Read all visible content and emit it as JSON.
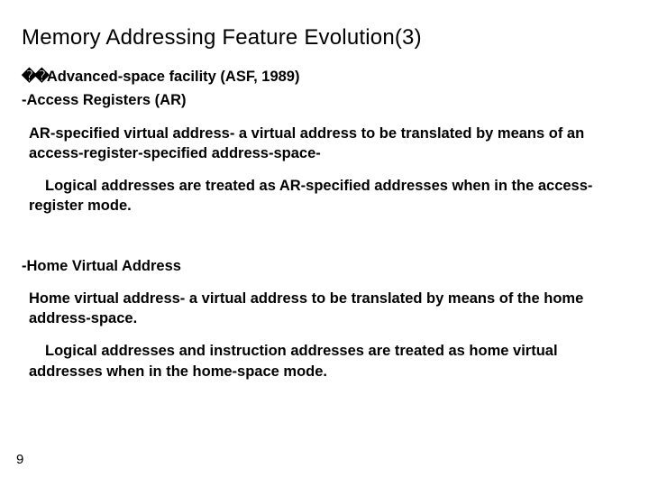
{
  "title": "Memory Addressing Feature Evolution(3)",
  "bullet_glyph": "��",
  "lines": {
    "asf_label": "Advanced-space facility",
    "asf_suffix": " (ASF, 1989)",
    "ar": "-Access Registers (AR)",
    "hva": "-Home Virtual Address"
  },
  "paras": {
    "arspec": "AR-specified virtual address-  a virtual address  to be translated by means of an access-register-specified address-space-",
    "arlogical": "Logical addresses are treated as AR-specified addresses when in the access-register mode.",
    "homev": "Home virtual address- a virtual address  to be translated by means of the home address-space.",
    "homelogical": "Logical addresses and instruction addresses are treated as home virtual addresses when in the home-space mode."
  },
  "page_number": "9"
}
